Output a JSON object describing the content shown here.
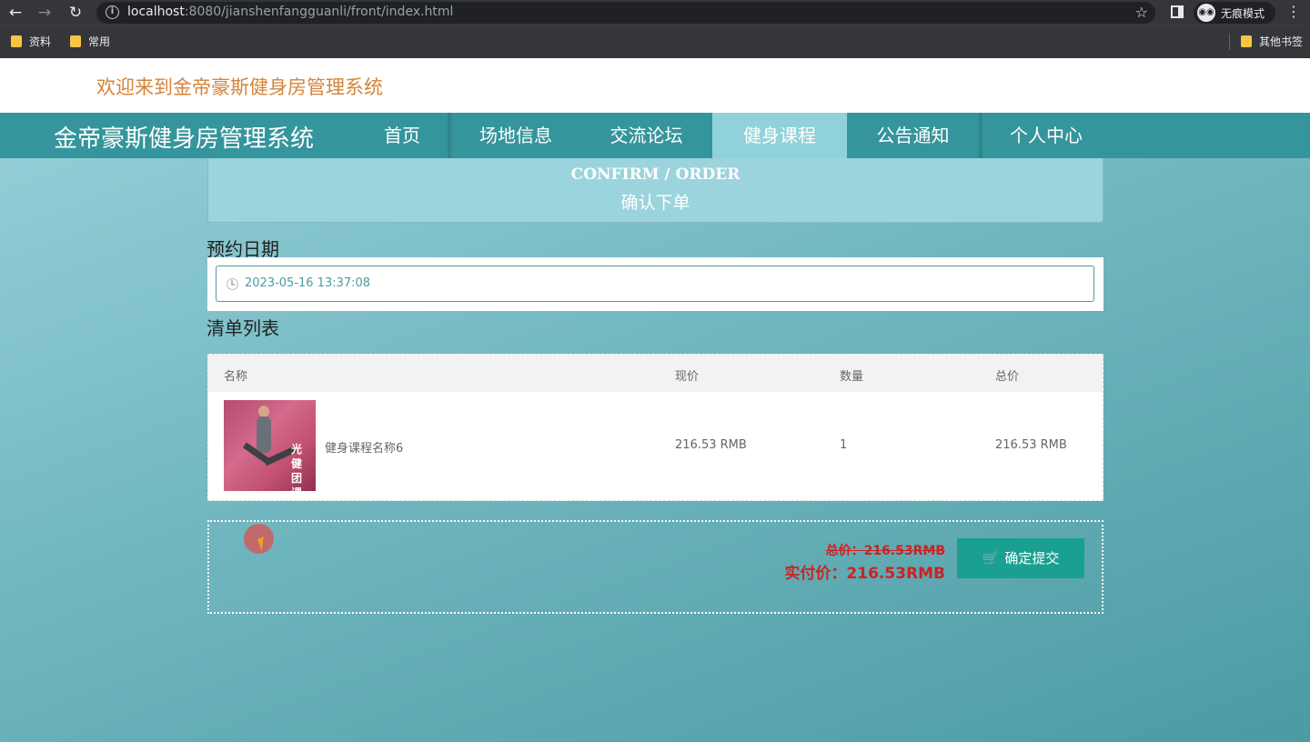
{
  "browser": {
    "url_host": "localhost",
    "url_rest": ":8080/jianshenfangguanli/front/index.html",
    "incognito_label": "无痕模式",
    "bookmarks": [
      "资料",
      "常用"
    ],
    "other_bookmarks": "其他书签"
  },
  "site": {
    "welcome": "欢迎来到金帝豪斯健身房管理系统",
    "brand": "金帝豪斯健身房管理系统",
    "nav": [
      "首页",
      "场地信息",
      "交流论坛",
      "健身课程",
      "公告通知",
      "个人中心"
    ],
    "active_nav": "健身课程"
  },
  "confirm": {
    "title_en": "CONFIRM / ORDER",
    "title_cn": "确认下单"
  },
  "booking": {
    "date_label": "预约日期",
    "date_value": "2023-05-16 13:37:08"
  },
  "list": {
    "title": "清单列表",
    "headers": [
      "名称",
      "现价",
      "数量",
      "总价"
    ],
    "rows": [
      {
        "thumb_text": "光 健 团 课 重 磅",
        "name": "健身课程名称6",
        "price": "216.53 RMB",
        "quantity": "1",
        "total": "216.53 RMB"
      }
    ]
  },
  "summary": {
    "original_total": "总价：216.53RMB",
    "actual_total": "实付价：216.53RMB",
    "submit_label": "确定提交"
  },
  "colors": {
    "nav_bg": "#35959c",
    "nav_active": "#91d2da",
    "welcome_text": "#d4843a",
    "price_red": "#cc2222",
    "submit_bg": "#1aa091"
  }
}
